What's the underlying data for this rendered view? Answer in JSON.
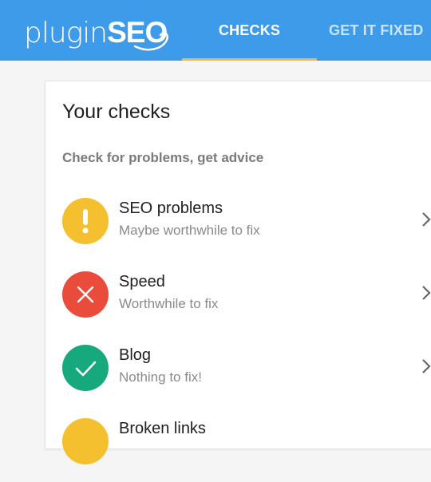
{
  "header": {
    "logo_light": "plugin",
    "logo_bold": "SEO",
    "tabs": [
      {
        "label": "CHECKS",
        "active": true
      },
      {
        "label": "GET IT FIXED",
        "active": false
      }
    ],
    "brand_color": "#3d9be9",
    "active_tab_underline_color": "#f5b53f"
  },
  "card": {
    "title": "Your checks",
    "subtitle": "Check for problems, get advice",
    "items": [
      {
        "title": "SEO problems",
        "status": "Maybe worthwhile to fix",
        "icon": "exclamation-icon",
        "color": "#f4c02f"
      },
      {
        "title": "Speed",
        "status": "Worthwhile to fix",
        "icon": "close-icon",
        "color": "#ea4c3c"
      },
      {
        "title": "Blog",
        "status": "Nothing to fix!",
        "icon": "check-icon",
        "color": "#16a97e"
      },
      {
        "title": "Broken links",
        "status": "",
        "icon": "warning-circle-icon",
        "color": "#f4c02f"
      }
    ]
  }
}
